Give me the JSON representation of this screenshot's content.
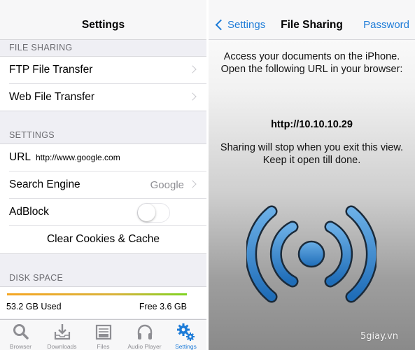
{
  "left": {
    "nav_title": "Settings",
    "sections": {
      "file_sharing": {
        "header": "FILE SHARING",
        "items": [
          "FTP File Transfer",
          "Web File Transfer"
        ]
      },
      "settings": {
        "header": "SETTINGS",
        "url_label": "URL",
        "url_value": "http://www.google.com",
        "search_engine_label": "Search Engine",
        "search_engine_value": "Google",
        "adblock_label": "AdBlock",
        "adblock_on": false,
        "clear_label": "Clear Cookies & Cache"
      },
      "disk_space": {
        "header": "DISK SPACE",
        "used": "53.2 GB Used",
        "free": "Free 3.6 GB"
      }
    },
    "tabbar": [
      {
        "label": "Browser",
        "icon": "search-icon",
        "active": false
      },
      {
        "label": "Downloads",
        "icon": "downloads-icon",
        "active": false
      },
      {
        "label": "Files",
        "icon": "files-icon",
        "active": false
      },
      {
        "label": "Audio Player",
        "icon": "headphones-icon",
        "active": false
      },
      {
        "label": "Settings",
        "icon": "gear-icon",
        "active": true
      }
    ]
  },
  "right": {
    "back_label": "Settings",
    "nav_title": "File Sharing",
    "nav_right": "Password",
    "message": "Access your documents on the iPhone. Open the following URL in your browser:",
    "url": "http://10.10.10.29",
    "note": "Sharing will stop when you exit this view. Keep it open till done.",
    "broadcast_icon": "wifi-broadcast-icon",
    "watermark": "5giay.vn"
  },
  "colors": {
    "accent": "#1e7cd8",
    "gray_text": "#8e8e93",
    "background": "#efeff4"
  }
}
